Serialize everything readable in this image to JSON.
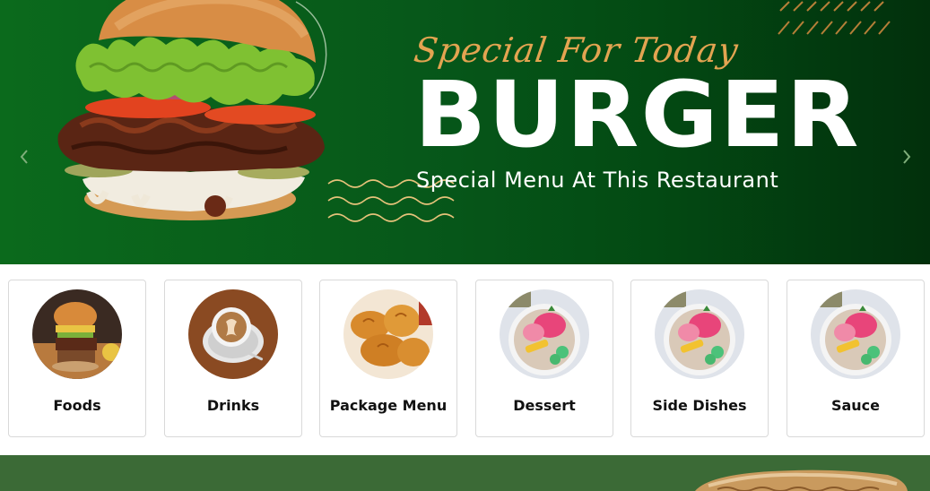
{
  "hero": {
    "tagline": "Special For Today",
    "title": "BURGER",
    "subtitle": "Special Menu At This Restaurant",
    "prev_icon": "chevron-left-icon",
    "next_icon": "chevron-right-icon",
    "colors": {
      "background_start": "#0b6a1c",
      "background_end": "#02300c",
      "tagline": "#e3a451",
      "title": "#ffffff"
    }
  },
  "categories": {
    "items": [
      {
        "label": "Foods",
        "image": "burger-photo"
      },
      {
        "label": "Drinks",
        "image": "coffee-cup-photo"
      },
      {
        "label": "Package Menu",
        "image": "fried-chicken-photo"
      },
      {
        "label": "Dessert",
        "image": "dessert-bowl-photo"
      },
      {
        "label": "Side Dishes",
        "image": "dessert-bowl-photo"
      },
      {
        "label": "Sauce",
        "image": "dessert-bowl-photo"
      }
    ]
  },
  "band": {
    "color": "#3b6a36"
  }
}
